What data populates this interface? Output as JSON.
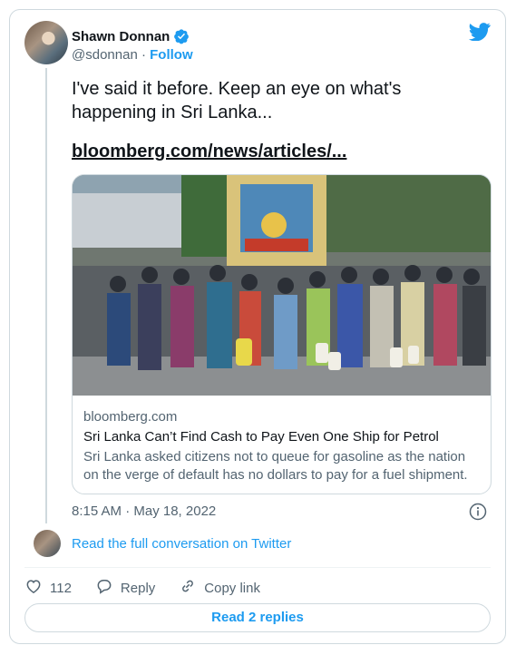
{
  "author": {
    "name": "Shawn Donnan",
    "handle": "@sdonnan",
    "separator": "·",
    "follow_label": "Follow"
  },
  "tweet": {
    "text": "I've said it before. Keep an eye on what's happening in Sri Lanka...",
    "link_text": "bloomberg.com/news/articles/..."
  },
  "link_card": {
    "domain": "bloomberg.com",
    "title": "Sri Lanka Can’t Find Cash to Pay Even One Ship for Petrol",
    "description": "Sri Lanka asked citizens not to queue for gasoline as the nation on the verge of default has no dollars to pay for a fuel shipment."
  },
  "meta": {
    "timestamp": "8:15 AM · May 18, 2022"
  },
  "conversation": {
    "read_full_label": "Read the full conversation on Twitter"
  },
  "actions": {
    "like_count": "112",
    "reply_label": "Reply",
    "copy_link_label": "Copy link"
  },
  "read_replies_label": "Read 2 replies",
  "colors": {
    "accent": "#1d9bf0",
    "text_primary": "#0f1419",
    "text_secondary": "#536471",
    "border": "#cfd9de"
  },
  "icons": [
    "verified-badge-icon",
    "twitter-bird-icon",
    "info-icon",
    "heart-icon",
    "reply-icon",
    "link-icon"
  ]
}
